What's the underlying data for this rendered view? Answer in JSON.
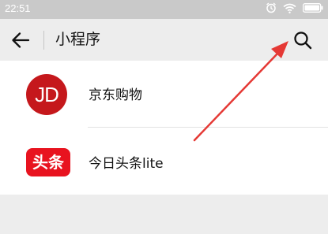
{
  "status_bar": {
    "time": "22:51",
    "icons": [
      "alarm-icon",
      "wifi-icon",
      "battery-icon"
    ]
  },
  "navbar": {
    "title": "小程序",
    "back_icon": "back-arrow-icon",
    "search_icon": "search-icon"
  },
  "mini_programs": [
    {
      "name": "京东购物",
      "icon_text": "JD",
      "icon_color": "#c5181c"
    },
    {
      "name": "今日头条lite",
      "icon_text": "头条",
      "icon_color": "#e8131f"
    }
  ],
  "colors": {
    "status_bar_bg": "#c9c9c9",
    "page_bg": "#ededed",
    "list_bg": "#ffffff",
    "annotation_arrow": "#e53935"
  }
}
